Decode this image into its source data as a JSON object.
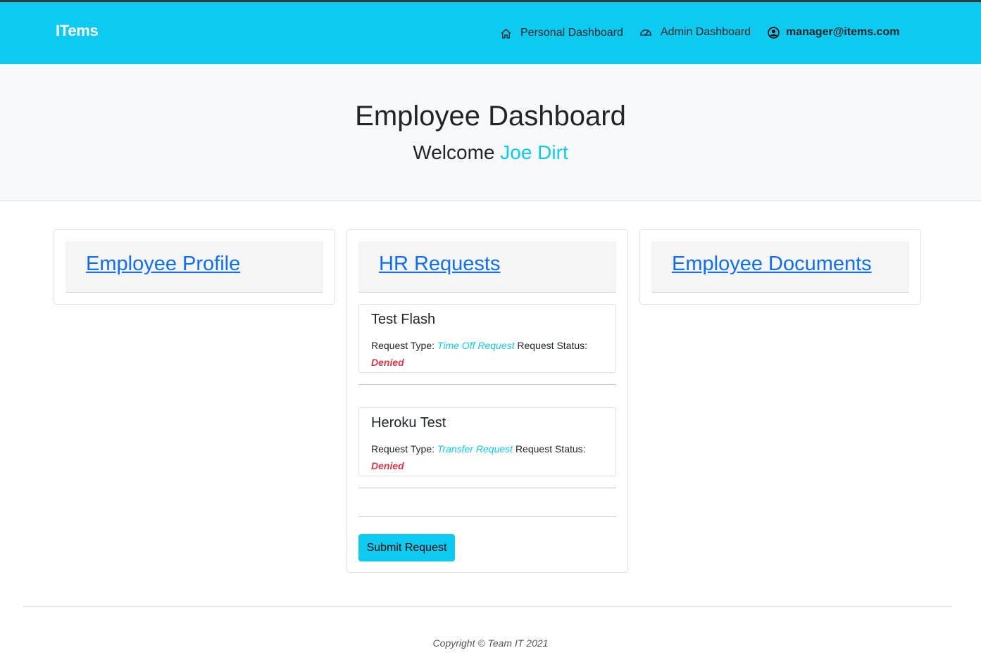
{
  "navbar": {
    "brand": "ITems",
    "personal_dashboard": "Personal Dashboard",
    "admin_dashboard": "Admin Dashboard",
    "user_email": "manager@items.com"
  },
  "hero": {
    "title": "Employee Dashboard",
    "welcome_prefix": "Welcome",
    "user_name": "Joe Dirt"
  },
  "cards": {
    "profile_link": "Employee Profile",
    "hr_link": "HR Requests",
    "documents_link": "Employee Documents"
  },
  "requests": [
    {
      "title": "Test Flash",
      "type_label": "Request Type:",
      "type_value": "Time Off Request",
      "status_label": "Request Status:",
      "status_value": "Denied"
    },
    {
      "title": "Heroku Test",
      "type_label": "Request Type:",
      "type_value": "Transfer Request",
      "status_label": "Request Status:",
      "status_value": "Denied"
    }
  ],
  "submit_label": "Submit Request",
  "footer": "Copyright © Team IT 2021",
  "colors": {
    "accent": "#0dcaf0",
    "link": "#0d6efd",
    "denied": "#dc3545"
  }
}
